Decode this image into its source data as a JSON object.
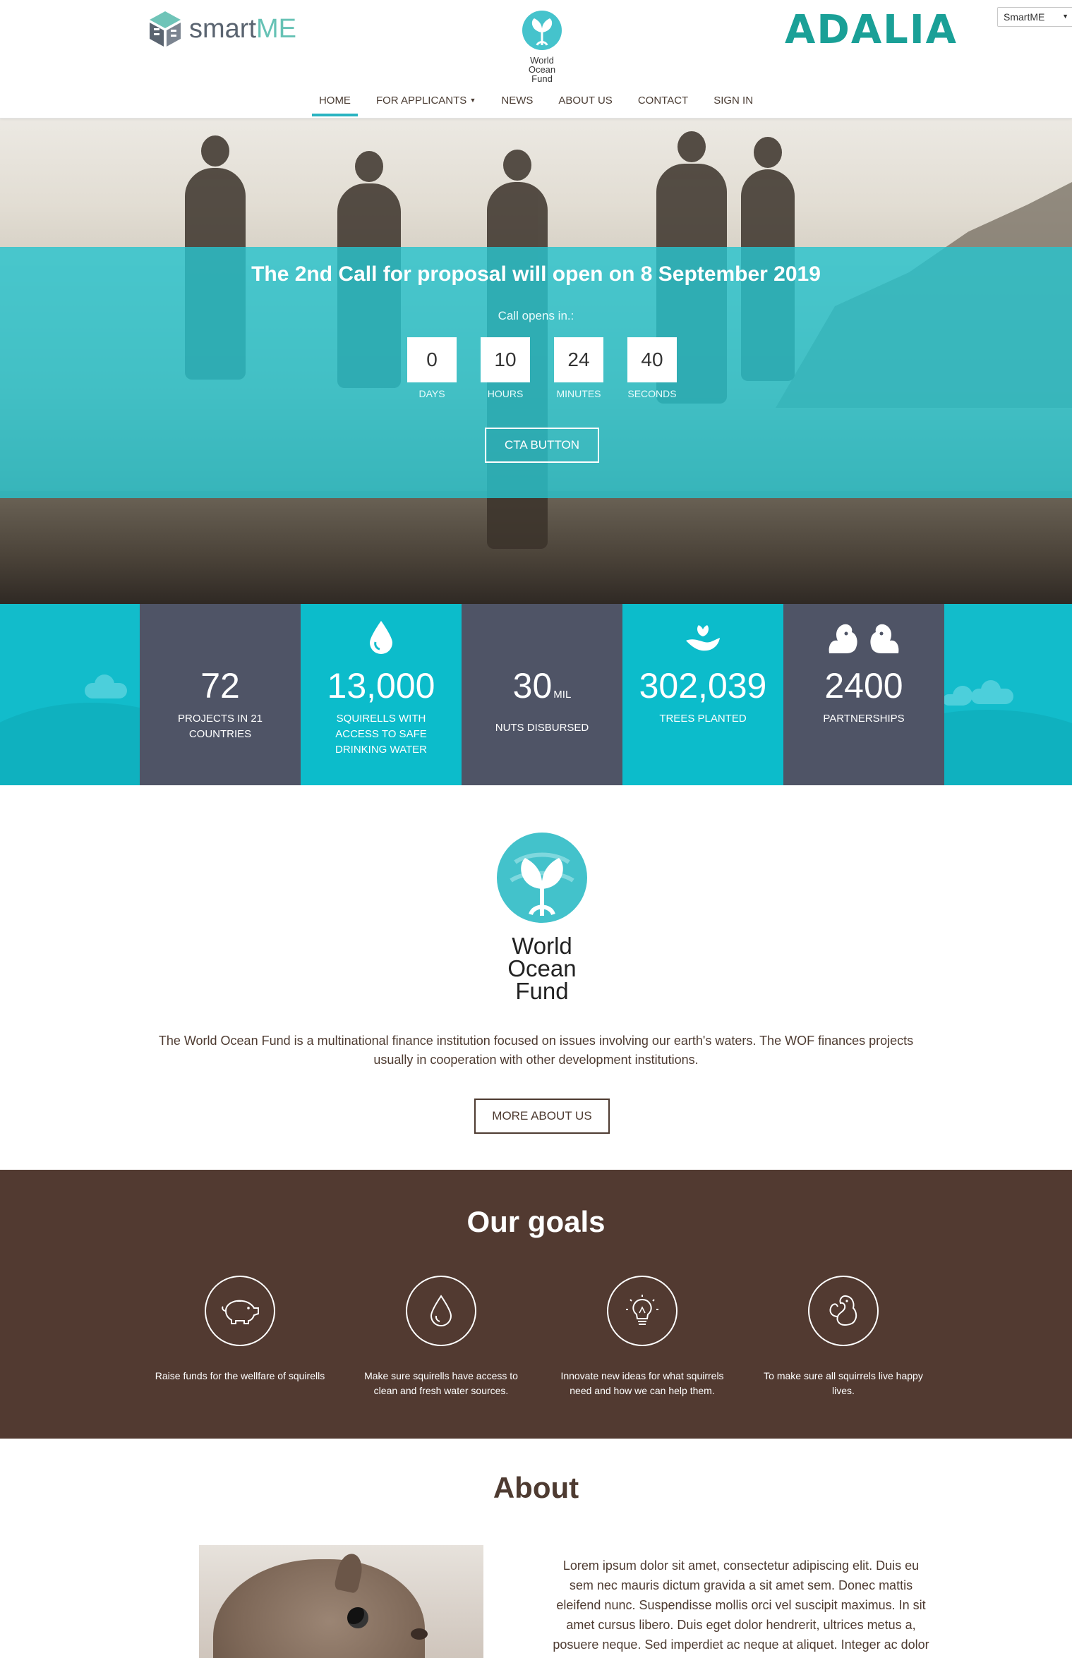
{
  "header": {
    "smartme_logo": {
      "part1": "smart",
      "part2": "ME"
    },
    "wof_mini_logo": {
      "line1": "World",
      "line2": "Ocean",
      "line3": "Fund"
    },
    "adalia_logo": "ADALIA",
    "language_select": "SmartME"
  },
  "nav": [
    {
      "label": "HOME",
      "active": true
    },
    {
      "label": "FOR APPLICANTS",
      "dropdown": true
    },
    {
      "label": "NEWS"
    },
    {
      "label": "ABOUT US"
    },
    {
      "label": "CONTACT"
    },
    {
      "label": "SIGN IN"
    }
  ],
  "hero": {
    "title": "The 2nd Call for proposal will open on 8 September 2019",
    "countdown_caption": "Call opens in.:",
    "countdown": [
      {
        "value": "0",
        "label": "DAYS"
      },
      {
        "value": "10",
        "label": "HOURS"
      },
      {
        "value": "24",
        "label": "MINUTES"
      },
      {
        "value": "40",
        "label": "SECONDS"
      }
    ],
    "cta_label": "CTA BUTTON"
  },
  "stats": [
    {
      "value": "72",
      "unit": "",
      "label": "PROJECTS IN 21 COUNTRIES",
      "icon": "none",
      "style": "dark"
    },
    {
      "value": "13,000",
      "unit": "",
      "label": "SQUIRELLS WITH ACCESS TO SAFE DRINKING WATER",
      "icon": "water-drop-icon",
      "style": "teal"
    },
    {
      "value": "30",
      "unit": "MIL",
      "label": "NUTS DISBURSED",
      "icon": "none",
      "style": "dark"
    },
    {
      "value": "302,039",
      "unit": "",
      "label": "TREES PLANTED",
      "icon": "plant-hand-icon",
      "style": "teal"
    },
    {
      "value": "2400",
      "unit": "",
      "label": "PARTNERSHIPS",
      "icon": "squirrels-icon",
      "style": "dark"
    }
  ],
  "intro": {
    "logo_text": {
      "line1": "World",
      "line2": "Ocean",
      "line3": "Fund"
    },
    "text": "The World Ocean Fund is a multinational finance institution focused on issues involving our earth's waters. The WOF finances projects usually in cooperation with other development institutions.",
    "button_label": "MORE ABOUT US"
  },
  "goals": {
    "title": "Our goals",
    "items": [
      {
        "text": "Raise funds for the wellfare of squirells",
        "icon": "piggy-bank-icon"
      },
      {
        "text": "Make sure squirells have access to clean and fresh water sources.",
        "icon": "water-drop-icon"
      },
      {
        "text": "Innovate new ideas for what squirrels need and how we can help them.",
        "icon": "lightbulb-icon"
      },
      {
        "text": "To make sure all squirrels live happy lives.",
        "icon": "squirrel-icon"
      }
    ]
  },
  "about": {
    "title": "About",
    "text": "Lorem ipsum dolor sit amet, consectetur adipiscing elit. Duis eu sem nec mauris dictum gravida a sit amet sem. Donec mattis eleifend nunc. Suspendisse mollis orci vel suscipit maximus. In sit amet cursus libero. Duis eget dolor hendrerit, ultrices metus a, posuere neque. Sed imperdiet ac neque at aliquet. Integer ac dolor congue"
  },
  "colors": {
    "teal": "#12bccb",
    "slate": "#4f5466",
    "brown": "#523a31",
    "nav_accent": "#2ab3c1",
    "adalia_green": "#1aa097"
  }
}
